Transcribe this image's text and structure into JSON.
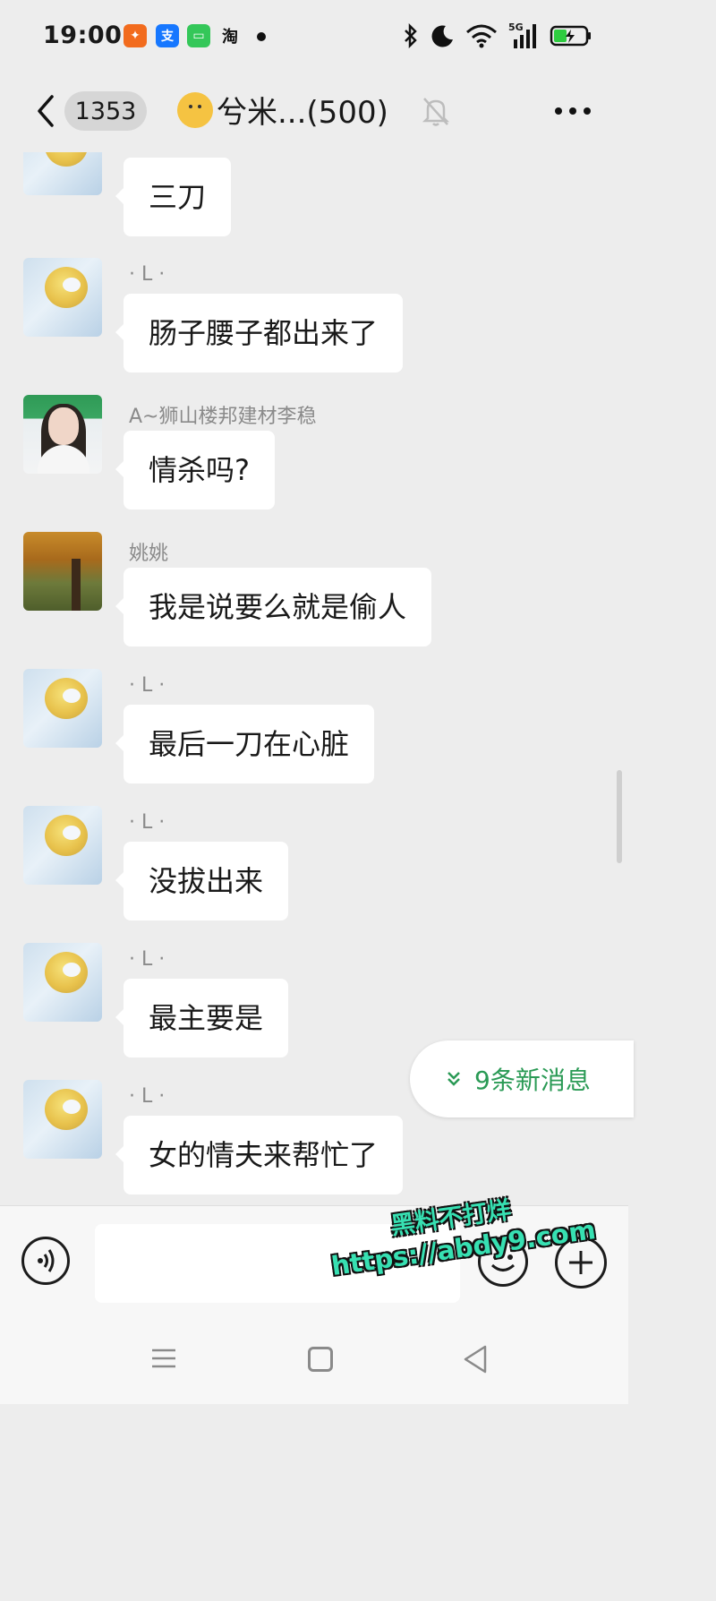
{
  "status_bar": {
    "time": "19:00",
    "app_icons": [
      {
        "name": "taobao-special-icon",
        "glyph": "🔥",
        "color": "#f26b1d"
      },
      {
        "name": "alipay-icon",
        "glyph": "支",
        "color": "#1677ff"
      },
      {
        "name": "messages-icon",
        "glyph": "▢",
        "color": "#34c759"
      },
      {
        "name": "taobao-icon",
        "glyph": "淘",
        "color": "#ffffff"
      }
    ],
    "network_label": "5G",
    "battery": "charging"
  },
  "header": {
    "unread_count": "1353",
    "title": "兮米...(500)"
  },
  "messages": [
    {
      "sender": "",
      "text": "三刀",
      "avatar": "l"
    },
    {
      "sender": "· L ·",
      "text": "肠子腰子都出来了",
      "avatar": "l"
    },
    {
      "sender": "A~狮山楼邦建材李稳",
      "text": "情杀吗?",
      "avatar": "a"
    },
    {
      "sender": "姚姚",
      "text": "我是说要么就是偷人",
      "avatar": "y"
    },
    {
      "sender": "· L ·",
      "text": "最后一刀在心脏",
      "avatar": "l"
    },
    {
      "sender": "· L ·",
      "text": "没拔出来",
      "avatar": "l"
    },
    {
      "sender": "· L ·",
      "text": "最主要是",
      "avatar": "l"
    },
    {
      "sender": "· L ·",
      "text": "女的情夫来帮忙了",
      "avatar": "l"
    }
  ],
  "new_messages": {
    "label": "9条新消息",
    "accent": "#2a9a55"
  },
  "input": {
    "placeholder": ""
  },
  "watermark": {
    "line1": "黑料不打烊",
    "line2": "https://abdy9.com",
    "color": "#37e0b2"
  }
}
